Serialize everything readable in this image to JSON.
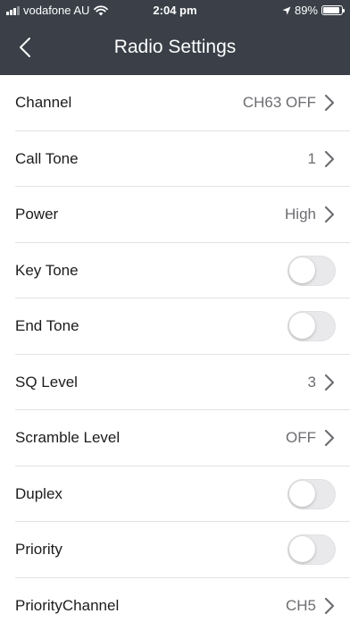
{
  "status_bar": {
    "carrier": "vodafone AU",
    "time": "2:04 pm",
    "battery": "89%",
    "battery_level": 0.89,
    "icons": [
      "signal-icon",
      "wifi-icon",
      "location-arrow-icon",
      "battery-icon"
    ]
  },
  "nav": {
    "title": "Radio Settings",
    "back_icon": "chevron-left-icon"
  },
  "settings": {
    "channel": {
      "label": "Channel",
      "value": "CH63 OFF"
    },
    "call_tone": {
      "label": "Call Tone",
      "value": "1"
    },
    "power": {
      "label": "Power",
      "value": "High"
    },
    "key_tone": {
      "label": "Key Tone",
      "on": false
    },
    "end_tone": {
      "label": "End Tone",
      "on": false
    },
    "sq_level": {
      "label": "SQ Level",
      "value": "3"
    },
    "scramble_level": {
      "label": "Scramble Level",
      "value": "OFF"
    },
    "duplex": {
      "label": "Duplex",
      "on": false
    },
    "priority": {
      "label": "Priority",
      "on": false
    },
    "priority_channel": {
      "label": "PriorityChannel",
      "value": "CH5"
    }
  },
  "colors": {
    "header_bg": "#3a3f48",
    "separator": "#e2e2e4",
    "value_text": "#6d6d72",
    "toggle_off": "#e9e9eb"
  }
}
